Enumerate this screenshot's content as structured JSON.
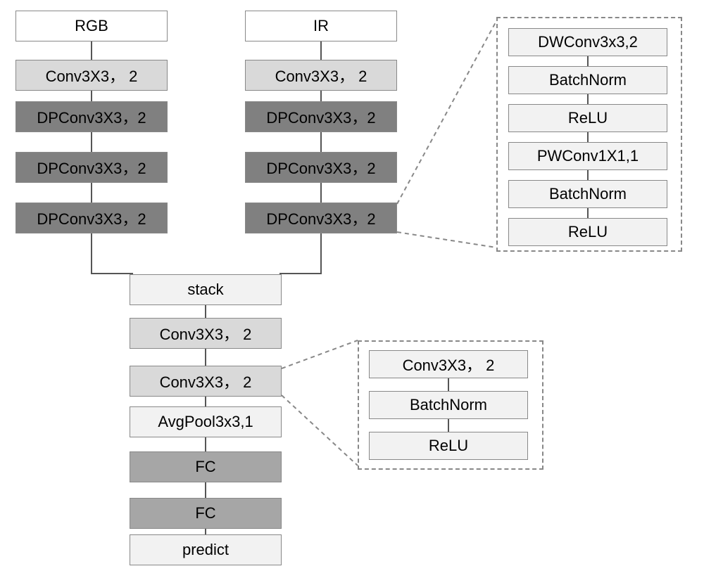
{
  "left": {
    "input": "RGB",
    "l1": "Conv3X3， 2",
    "l2": "DPConv3X3，2",
    "l3": "DPConv3X3，2",
    "l4": "DPConv3X3，2"
  },
  "right": {
    "input": "IR",
    "l1": "Conv3X3， 2",
    "l2": "DPConv3X3，2",
    "l3": "DPConv3X3，2",
    "l4": "DPConv3X3，2"
  },
  "merge": {
    "stack": "stack",
    "c1": "Conv3X3， 2",
    "c2": "Conv3X3， 2",
    "pool": "AvgPool3x3,1",
    "fc1": "FC",
    "fc2": "FC",
    "pred": "predict"
  },
  "detailDP": {
    "l1": "DWConv3x3,2",
    "l2": "BatchNorm",
    "l3": "ReLU",
    "l4": "PWConv1X1,1",
    "l5": "BatchNorm",
    "l6": "ReLU"
  },
  "detailConv": {
    "l1": "Conv3X3， 2",
    "l2": "BatchNorm",
    "l3": "ReLU"
  }
}
